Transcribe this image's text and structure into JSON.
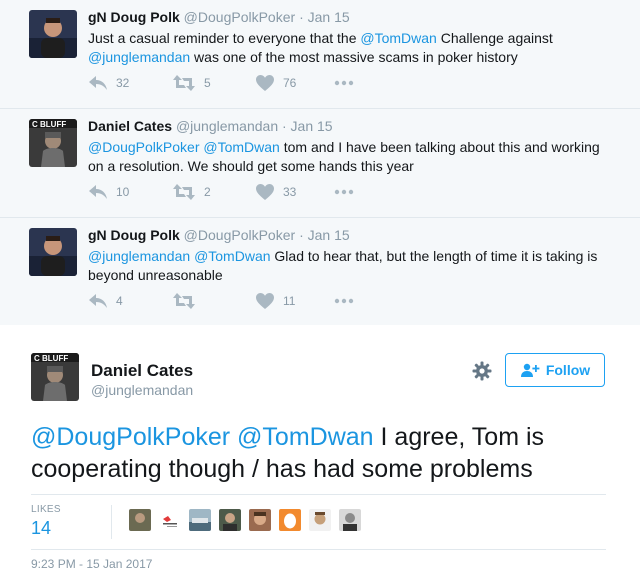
{
  "thread": [
    {
      "name": "gN Doug Polk",
      "handle": "@DougPolkPoker",
      "time": "· Jan 15",
      "text": [
        {
          "t": "Just a casual reminder to everyone that the ",
          "m": false
        },
        {
          "t": "@TomDwan",
          "m": true
        },
        {
          "t": " Challenge against ",
          "m": false
        },
        {
          "t": "@junglemandan",
          "m": true
        },
        {
          "t": " was one of the most massive scams in poker history",
          "m": false
        }
      ],
      "replies": "32",
      "retweets": "5",
      "likes": "76"
    },
    {
      "name": "Daniel Cates",
      "handle": "@junglemandan",
      "time": "· Jan 15",
      "text": [
        {
          "t": "@DougPolkPoker",
          "m": true
        },
        {
          "t": " ",
          "m": false
        },
        {
          "t": "@TomDwan",
          "m": true
        },
        {
          "t": " tom and I have been talking about this and working on a resolution. We should get some hands this year",
          "m": false
        }
      ],
      "replies": "10",
      "retweets": "2",
      "likes": "33"
    },
    {
      "name": "gN Doug Polk",
      "handle": "@DougPolkPoker",
      "time": "· Jan 15",
      "text": [
        {
          "t": "@junglemandan",
          "m": true
        },
        {
          "t": " ",
          "m": false
        },
        {
          "t": "@TomDwan",
          "m": true
        },
        {
          "t": " Glad to hear that, but the length of time it is taking is beyond unreasonable",
          "m": false
        }
      ],
      "replies": "4",
      "retweets": "",
      "likes": "11"
    }
  ],
  "main": {
    "name": "Daniel Cates",
    "handle": "@junglemandan",
    "follow_label": "Follow",
    "text": [
      {
        "t": "@DougPolkPoker",
        "m": true
      },
      {
        "t": " ",
        "m": false
      },
      {
        "t": "@TomDwan",
        "m": true
      },
      {
        "t": " I agree, Tom is cooperating though / has had some problems",
        "m": false
      }
    ],
    "likes_label": "LIKES",
    "likes_count": "14",
    "likers": [
      {
        "color": "#6b6a52"
      },
      {
        "color": "#e9e6e3"
      },
      {
        "color": "#6f8a99"
      },
      {
        "color": "#4d5a4a"
      },
      {
        "color": "#9a6a4f"
      },
      {
        "color": "#f28a2e"
      },
      {
        "color": "#c6a07a"
      },
      {
        "color": "#d8d8d8"
      }
    ],
    "date": "9:23 PM - 15 Jan 2017"
  },
  "colors": {
    "mention": "#1b95e0",
    "follow_blue": "#1da1f2",
    "icon_gray": "#aab8c2"
  },
  "icons": [
    "reply-icon",
    "retweet-icon",
    "heart-icon",
    "more-icon",
    "gear-icon",
    "add-user-icon"
  ]
}
